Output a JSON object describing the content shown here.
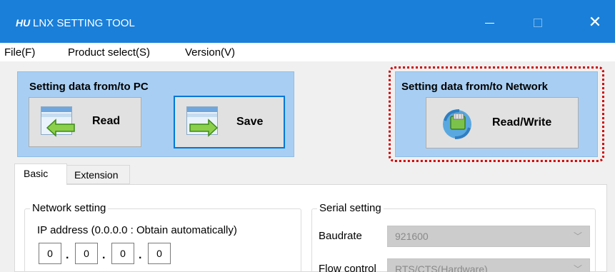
{
  "window": {
    "logo_text": "HU",
    "title": "LNX SETTING TOOL",
    "titlebar_color": "#1a7fd9"
  },
  "menu": {
    "items": [
      {
        "label": "File(F)"
      },
      {
        "label": "Product select(S)"
      },
      {
        "label": "Version(V)"
      }
    ]
  },
  "pc_panel": {
    "title": "Setting data from/to PC",
    "read_label": "Read",
    "save_label": "Save"
  },
  "network_panel": {
    "title": "Setting data from/to Network",
    "rw_label": "Read/Write",
    "highlight_color": "#d00000"
  },
  "tabs": [
    {
      "label": "Basic",
      "selected": true
    },
    {
      "label": "Extension",
      "selected": false
    }
  ],
  "network_setting": {
    "legend": "Network setting",
    "ip_caption": "IP address (0.0.0.0 : Obtain automatically)",
    "ip_octets": [
      "0",
      "0",
      "0",
      "0"
    ]
  },
  "serial_setting": {
    "legend": "Serial setting",
    "baudrate_label": "Baudrate",
    "baudrate_value": "921600",
    "flow_label": "Flow control",
    "flow_value": "RTS/CTS(Hardware)"
  }
}
